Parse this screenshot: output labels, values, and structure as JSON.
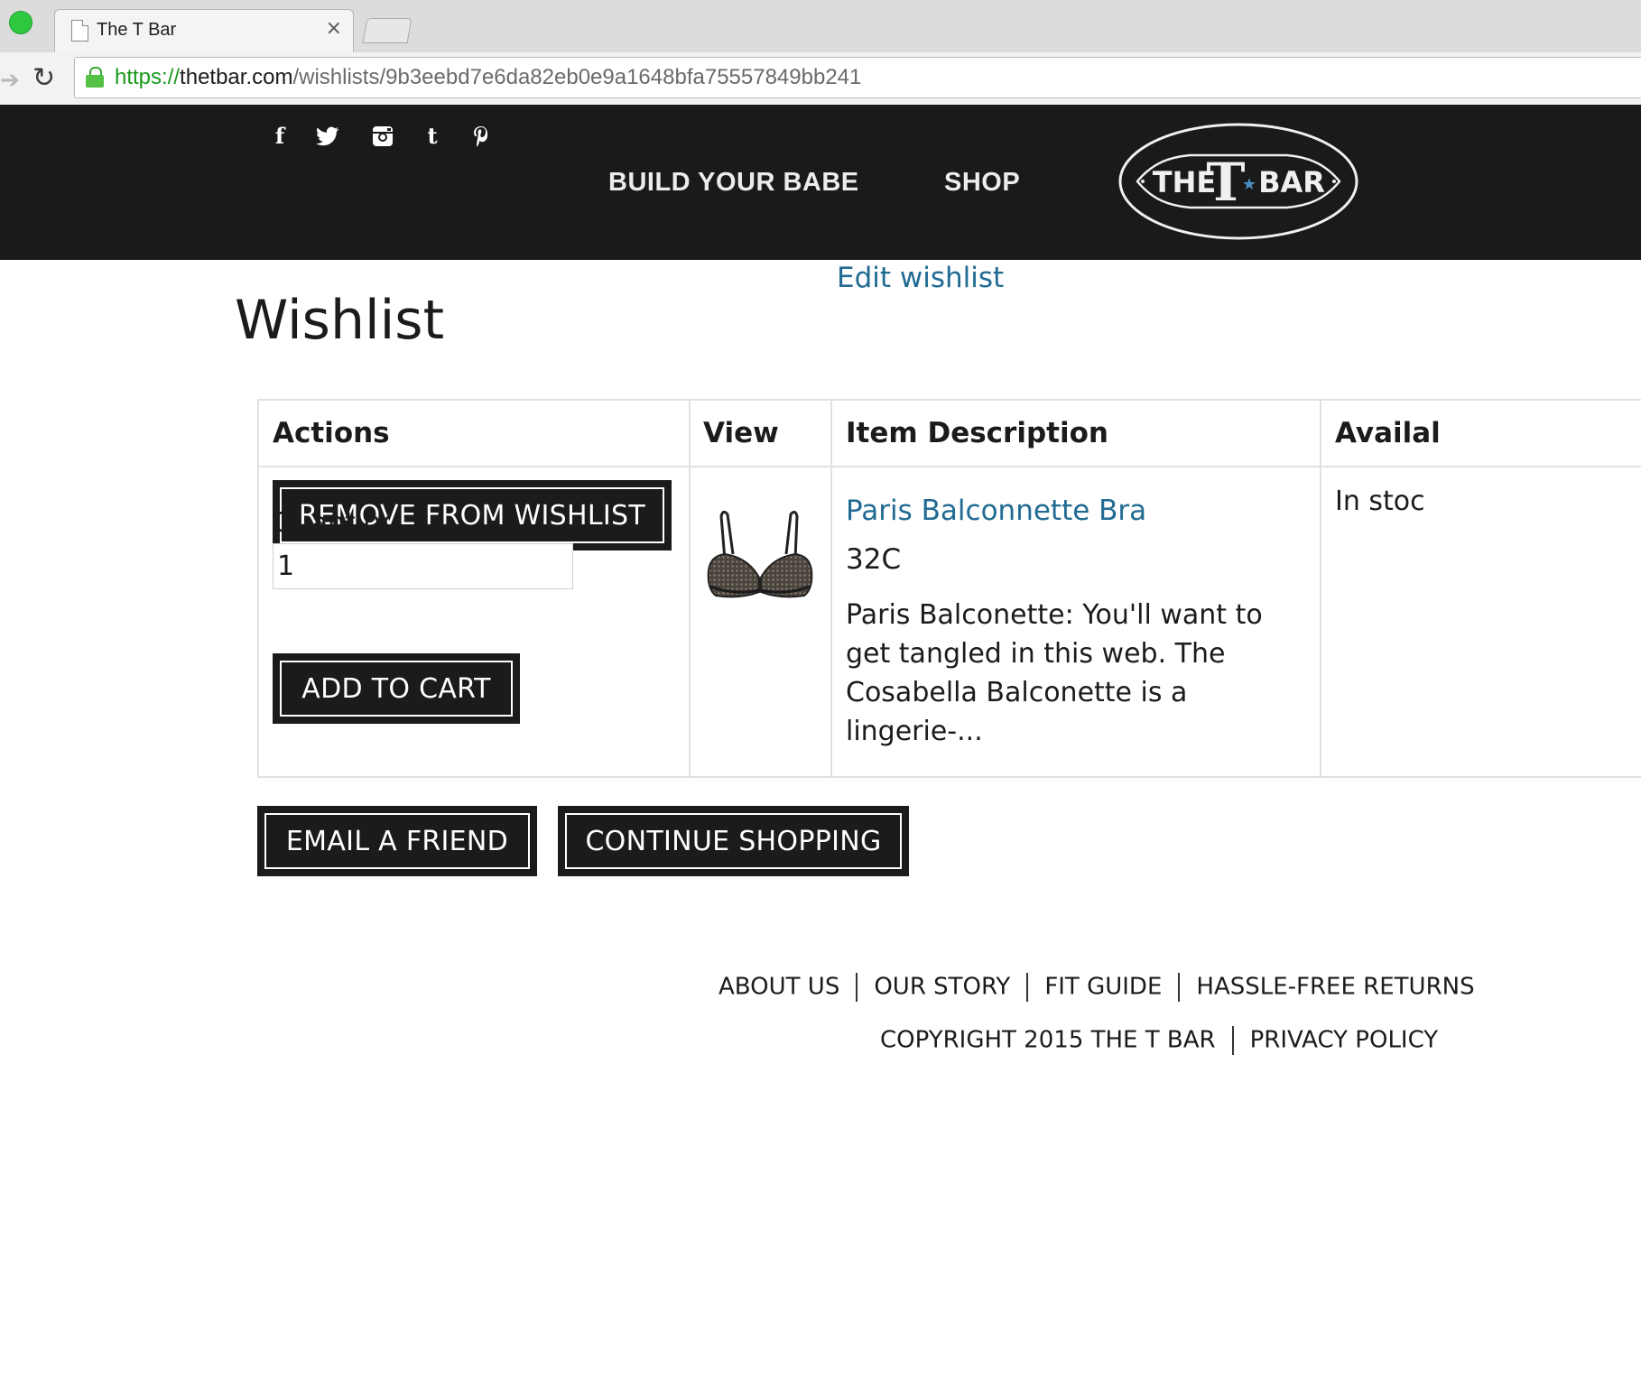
{
  "browser": {
    "tab_title": "The T Bar",
    "tab_close": "×",
    "url_scheme": "https://",
    "url_host": "thetbar.com",
    "url_path": "/wishlists/9b3eebd7e6da82eb0e9a1648bfa75557849bb241"
  },
  "header": {
    "social_icons": [
      "facebook-icon",
      "twitter-icon",
      "instagram-icon",
      "tumblr-icon",
      "pinterest-icon"
    ],
    "nav": {
      "build": "BUILD YOUR BABE",
      "shop": "SHOP"
    },
    "logo_text": "THE T BAR"
  },
  "page": {
    "edit_link": "Edit wishlist",
    "title": "Wishlist"
  },
  "table": {
    "headers": [
      "Actions",
      "View",
      "Item Description",
      "Availal"
    ],
    "row": {
      "remove_button": "REMOVE FROM WISHLIST",
      "quantity_label": "Quantity",
      "quantity_value": "1",
      "add_button": "ADD TO CART",
      "product_name": "Paris Balconnette Bra",
      "size": "32C",
      "description": "Paris Balconette: You'll want to get tangled in this web. The Cosabella Balconette is a lingerie-...",
      "availability": "In stoc"
    }
  },
  "actions": {
    "email": "EMAIL A FRIEND",
    "continue": "CONTINUE SHOPPING"
  },
  "footer": {
    "links": [
      "ABOUT US",
      "OUR STORY",
      "FIT GUIDE",
      "HASSLE-FREE RETURNS"
    ],
    "copyright": "COPYRIGHT 2015 THE T BAR",
    "privacy": "PRIVACY POLICY"
  },
  "colors": {
    "header_bg": "#1a1a1a",
    "link": "#216b93",
    "button_bg": "#1b1b1b"
  }
}
